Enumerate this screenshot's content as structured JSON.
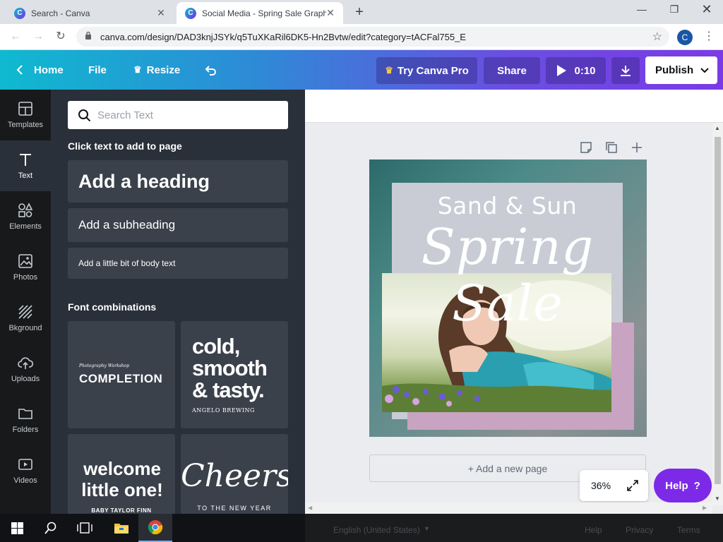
{
  "browser": {
    "tabs": [
      {
        "title": "Search - Canva",
        "active": false
      },
      {
        "title": "Social Media - Spring Sale Graph",
        "active": true
      }
    ],
    "favicon_letter": "C",
    "url": "canva.com/design/DAD3knjJSYk/q5TuXKaRil6DK5-Hn2Bvtw/edit?category=tACFal755_E",
    "profile_letter": "C"
  },
  "header": {
    "home": "Home",
    "file": "File",
    "resize": "Resize",
    "try_pro": "Try Canva Pro",
    "share": "Share",
    "play_time": "0:10",
    "publish": "Publish"
  },
  "rail": {
    "items": [
      {
        "label": "Templates",
        "icon": "templates-icon"
      },
      {
        "label": "Text",
        "icon": "text-icon"
      },
      {
        "label": "Elements",
        "icon": "elements-icon"
      },
      {
        "label": "Photos",
        "icon": "photos-icon"
      },
      {
        "label": "Bkground",
        "icon": "background-icon"
      },
      {
        "label": "Uploads",
        "icon": "uploads-icon"
      },
      {
        "label": "Folders",
        "icon": "folders-icon"
      },
      {
        "label": "Videos",
        "icon": "videos-icon"
      }
    ],
    "active": "Text"
  },
  "panel": {
    "search_placeholder": "Search Text",
    "section_title": "Click text to add to page",
    "add_heading": "Add a heading",
    "add_subheading": "Add a subheading",
    "add_body": "Add a little bit of body text",
    "font_combinations_title": "Font combinations",
    "font_cards": [
      {
        "small": "Photography Workshop",
        "big": "COMPLETION"
      },
      {
        "big": "cold, smooth & tasty.",
        "small": "ANGELO BREWING"
      },
      {
        "big": "welcome little one!",
        "small": "BABY TAYLOR FINN"
      },
      {
        "big": "Cheers",
        "small": "TO THE NEW YEAR"
      }
    ]
  },
  "design": {
    "line1": "Sand & Sun",
    "line2": "Spring Sale"
  },
  "canvas": {
    "add_page": "+ Add a new page",
    "zoom": "36%",
    "help": "Help",
    "help_mark": "?"
  },
  "footer": {
    "language": "English (United States)",
    "help": "Help",
    "privacy": "Privacy",
    "terms": "Terms"
  }
}
